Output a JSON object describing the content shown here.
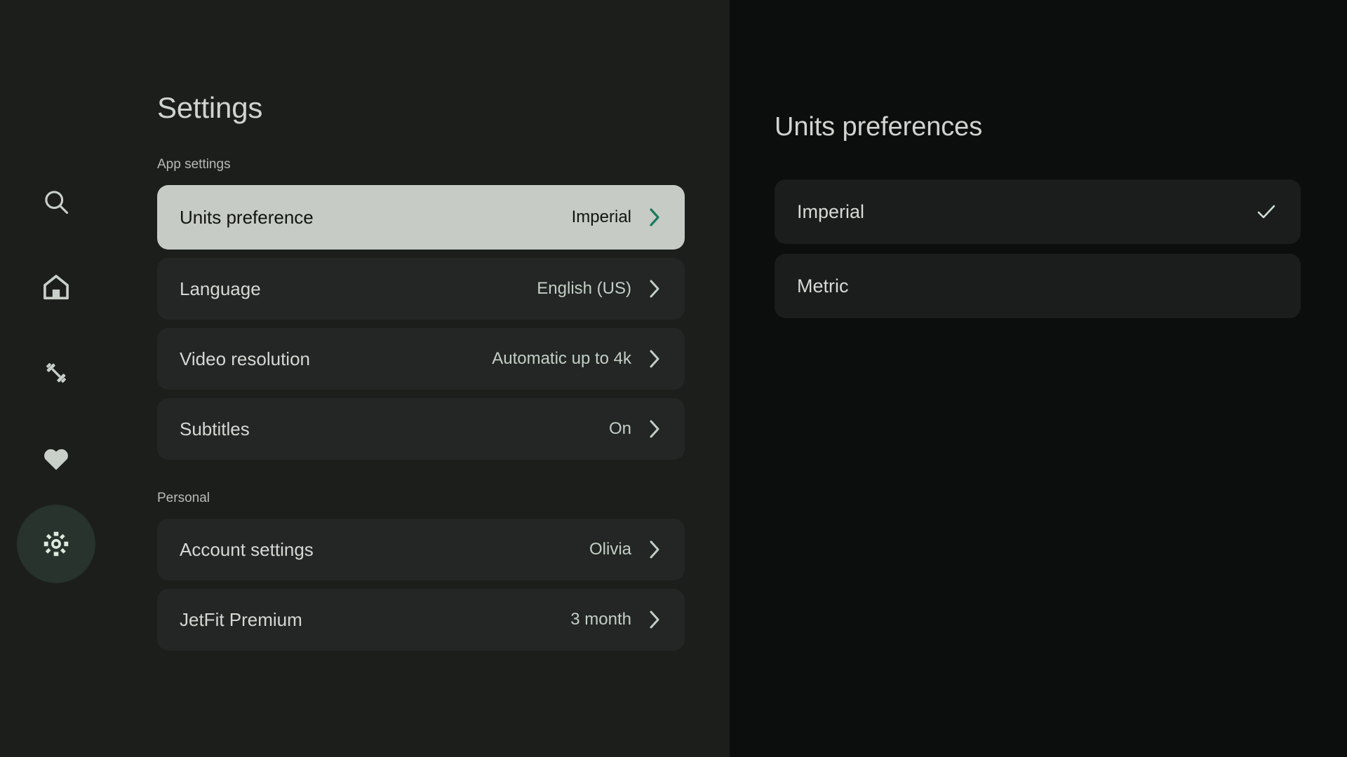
{
  "colors": {
    "left_panel_bg": "#1c1e1c",
    "right_panel_bg": "#0c0e0d",
    "row_bg": "#232624",
    "selected_row_bg": "#c6cbc6",
    "accent_teal": "#1a7a5e",
    "mint_text": "#c3cfc6",
    "rail_active_bg": "#27332c"
  },
  "sidebar": {
    "items": [
      {
        "icon": "search-icon",
        "name": "search",
        "active": false
      },
      {
        "icon": "home-icon",
        "name": "home",
        "active": false
      },
      {
        "icon": "dumbbell-icon",
        "name": "workouts",
        "active": false
      },
      {
        "icon": "heart-icon",
        "name": "favorites",
        "active": false
      },
      {
        "icon": "gear-icon",
        "name": "settings",
        "active": true
      }
    ]
  },
  "left": {
    "title": "Settings",
    "sections": [
      {
        "label": "App settings",
        "rows": [
          {
            "label": "Units preference",
            "value": "Imperial",
            "selected": true
          },
          {
            "label": "Language",
            "value": "English (US)",
            "selected": false
          },
          {
            "label": "Video resolution",
            "value": "Automatic up to 4k",
            "selected": false
          },
          {
            "label": "Subtitles",
            "value": "On",
            "selected": false
          }
        ]
      },
      {
        "label": "Personal",
        "rows": [
          {
            "label": "Account settings",
            "value": "Olivia",
            "selected": false
          },
          {
            "label": "JetFit Premium",
            "value": "3 month",
            "selected": false
          }
        ]
      }
    ]
  },
  "right": {
    "title": "Units preferences",
    "options": [
      {
        "label": "Imperial",
        "checked": true
      },
      {
        "label": "Metric",
        "checked": false
      }
    ]
  }
}
